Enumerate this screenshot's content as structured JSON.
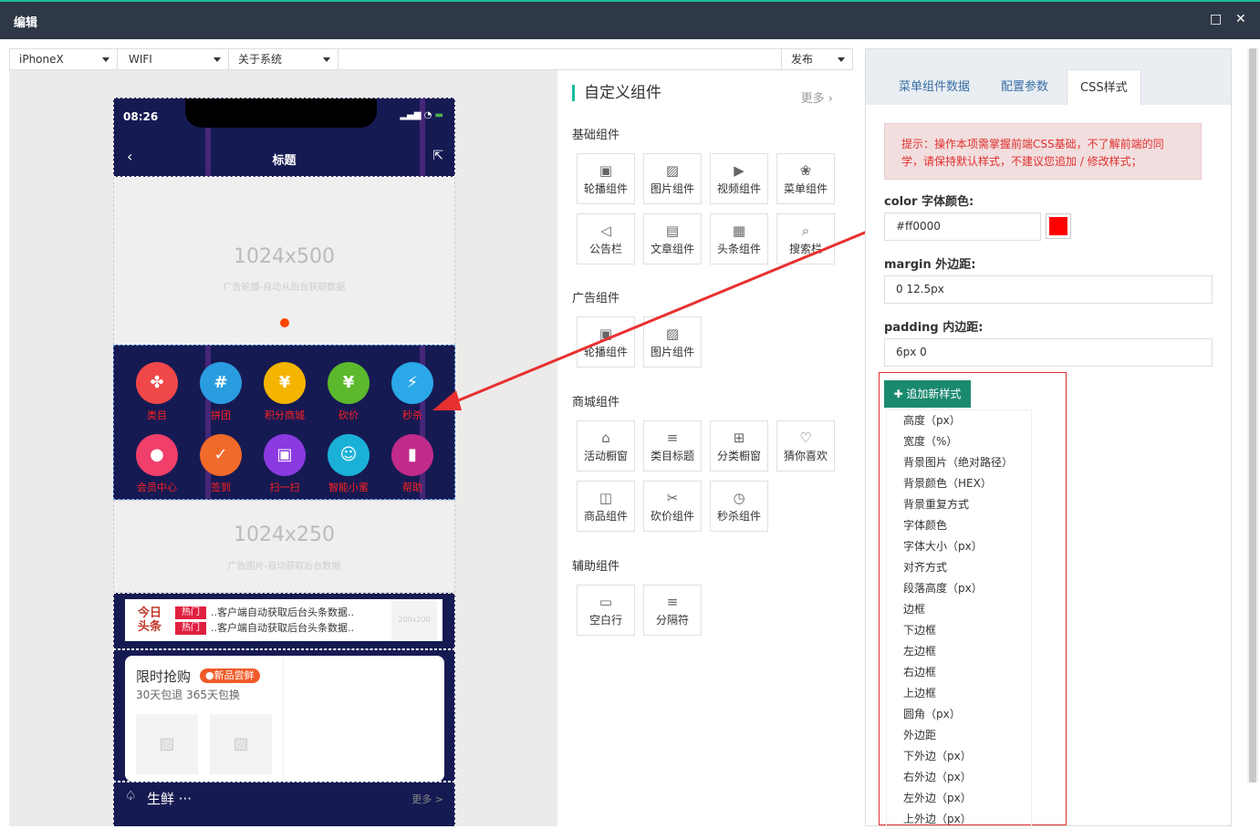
{
  "window": {
    "title": "编辑",
    "restore_icon": "□",
    "close_icon": "✕"
  },
  "toolbar": {
    "device": "iPhoneX",
    "network": "WIFI",
    "system": "关于系统",
    "publish": "发布"
  },
  "phone": {
    "status_time": "08:26",
    "page_title": "标题",
    "banner_size": "1024x500",
    "banner_hint": "广告轮播-自动从后台获取数据",
    "menu_items": [
      {
        "label": "类目",
        "color": "#f04848",
        "glyph": "✤"
      },
      {
        "label": "拼团",
        "color": "#2a9de0",
        "glyph": "#"
      },
      {
        "label": "积分商城",
        "color": "#f4b400",
        "glyph": "¥"
      },
      {
        "label": "砍价",
        "color": "#5cb82c",
        "glyph": "¥"
      },
      {
        "label": "秒杀",
        "color": "#2aa8e8",
        "glyph": "⚡"
      },
      {
        "label": "会员中心",
        "color": "#ef3f6a",
        "glyph": "●"
      },
      {
        "label": "签到",
        "color": "#f06a2a",
        "glyph": "✓"
      },
      {
        "label": "扫一扫",
        "color": "#8a3ae0",
        "glyph": "▣"
      },
      {
        "label": "智能小蜜",
        "color": "#1ab0d8",
        "glyph": "☺"
      },
      {
        "label": "帮助",
        "color": "#c02b8a",
        "glyph": "▮"
      }
    ],
    "banner2_size": "1024x250",
    "banner2_hint": "广告图片-自动获取后台数据",
    "news": {
      "logo_line1": "今日",
      "logo_line2": "头条",
      "tag": "热门",
      "line1": "..客户端自动获取后台头条数据..",
      "line2": "..客户端自动获取后台头条数据..",
      "img_size": "200x200"
    },
    "flash": {
      "title": "限时抢购",
      "badge": "●新品尝鲜",
      "subtitle": "30天包退 365天包换"
    },
    "fresh": {
      "title": "生鲜 ···",
      "more": "更多 >"
    }
  },
  "palette": {
    "heading": "自定义组件",
    "more": "更多",
    "sections": [
      {
        "title": "基础组件",
        "items": [
          {
            "label": "轮播组件",
            "icon": "▣"
          },
          {
            "label": "图片组件",
            "icon": "▨"
          },
          {
            "label": "视频组件",
            "icon": "▶"
          },
          {
            "label": "菜单组件",
            "icon": "❀"
          },
          {
            "label": "公告栏",
            "icon": "◁"
          },
          {
            "label": "文章组件",
            "icon": "▤"
          },
          {
            "label": "头条组件",
            "icon": "▦"
          },
          {
            "label": "搜索栏",
            "icon": "⌕"
          }
        ]
      },
      {
        "title": "广告组件",
        "items": [
          {
            "label": "轮播组件",
            "icon": "▣"
          },
          {
            "label": "图片组件",
            "icon": "▨"
          }
        ]
      },
      {
        "title": "商城组件",
        "items": [
          {
            "label": "活动橱窗",
            "icon": "⌂"
          },
          {
            "label": "类目标题",
            "icon": "≡"
          },
          {
            "label": "分类橱窗",
            "icon": "⊞"
          },
          {
            "label": "猜你喜欢",
            "icon": "♡"
          },
          {
            "label": "商品组件",
            "icon": "◫"
          },
          {
            "label": "砍价组件",
            "icon": "✂"
          },
          {
            "label": "秒杀组件",
            "icon": "◷"
          }
        ]
      },
      {
        "title": "辅助组件",
        "items": [
          {
            "label": "空白行",
            "icon": "▭"
          },
          {
            "label": "分隔符",
            "icon": "≡"
          }
        ]
      }
    ]
  },
  "panel": {
    "tabs": [
      "菜单组件数据",
      "配置参数",
      "CSS样式"
    ],
    "hint": "提示：操作本项需掌握前端CSS基础，不了解前端的同学，请保持默认样式，不建议您追加 / 修改样式；",
    "color_label": "color 字体颜色:",
    "color_value": "#ff0000",
    "margin_label": "margin 外边距:",
    "margin_value": "0 12.5px",
    "padding_label": "padding 内边距:",
    "padding_value": "6px 0",
    "add_button": "✚ 追加新样式",
    "style_options": [
      "高度（px）",
      "宽度（%）",
      "背景图片（绝对路径）",
      "背景颜色（HEX）",
      "背景重复方式",
      "字体颜色",
      "字体大小（px）",
      "对齐方式",
      "段落高度（px）",
      "边框",
      "下边框",
      "左边框",
      "右边框",
      "上边框",
      "圆角（px）",
      "外边距",
      "下外边（px）",
      "右外边（px）",
      "左外边（px）",
      "上外边（px）"
    ]
  },
  "colors": {
    "accent": "#1abc9c",
    "nav_bg": "#161a52",
    "danger": "#e03030",
    "button": "#1a8a6e"
  }
}
